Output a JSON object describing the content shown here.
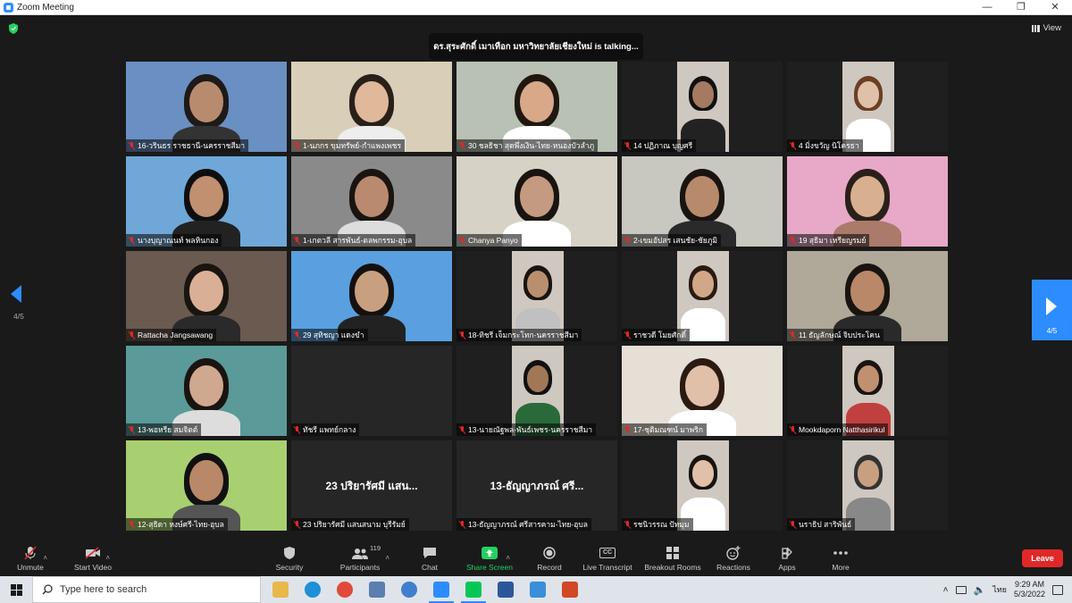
{
  "window": {
    "title": "Zoom Meeting",
    "controls": [
      "—",
      "❐",
      "✕"
    ]
  },
  "meeting": {
    "talking_banner": "ดร.สุระศักดิ์ เมาเทือก มหาวิทยาลัยเชียงใหม่ is talking...",
    "view_label": "View",
    "page_indicator_left": "4/5",
    "page_indicator_right": "4/5"
  },
  "tiles": [
    {
      "name": "16-วรินธร ราชธานี-นครราชสีมา",
      "bg": "#6a8fc2",
      "skin": "#b98b6e",
      "hair": "#1e1a18",
      "shirt": "#333"
    },
    {
      "name": "1-นภกร ขุมทรัพย์-กำแพงเพชร",
      "bg": "#d9cfb8",
      "skin": "#e0b89a",
      "hair": "#2a201a",
      "shirt": "#eee"
    },
    {
      "name": "30 ชลธิชา สุดพึ่งเงิน-ไทย-หนองบัวลำภู",
      "bg": "#b8c1b3",
      "skin": "#d8a888",
      "hair": "#201810",
      "shirt": "#fff"
    },
    {
      "name": "14 ปฏิภาณ บุญศรี",
      "bg": "#1f1f1f",
      "skin": "#a47a60",
      "hair": "#111",
      "shirt": "#222",
      "inset": true
    },
    {
      "name": "4 มิ่งขวัญ นิโครธา",
      "bg": "#222",
      "skin": "#e0c0a8",
      "hair": "#6a3f24",
      "shirt": "#fff",
      "inset": true
    },
    {
      "name": "นางบุญาณนท์ พลหินกอง",
      "bg": "#6fa8d8",
      "skin": "#c09070",
      "hair": "#0f0f0f",
      "shirt": "#222"
    },
    {
      "name": "1-เกตวลี สารพันธ์-ตลพกรรม-อุบล",
      "bg": "#8a8a8a",
      "skin": "#b98a70",
      "hair": "#1a1410",
      "shirt": "#ddd"
    },
    {
      "name": "Chanya Panyo",
      "bg": "#d6d2c6",
      "skin": "#c49a80",
      "hair": "#1a1410",
      "shirt": "#fff"
    },
    {
      "name": "2-เขมอัปสร เสนชัย-ชัยภูมิ",
      "bg": "#c8c8c0",
      "skin": "#b88a6c",
      "hair": "#1a1410",
      "shirt": "#2a2a2a"
    },
    {
      "name": "19 สุธิมา เหรียญรมย์",
      "bg": "#e8a8c8",
      "skin": "#d8b090",
      "hair": "#2a201a",
      "shirt": "#aa7a6a"
    },
    {
      "name": "Rattacha Jangsawang",
      "bg": "#6a5a50",
      "skin": "#d9b095",
      "hair": "#1a1410",
      "shirt": "#2a2a2a"
    },
    {
      "name": "29 สุทิชญา แดงขำ",
      "bg": "#5aa0e0",
      "skin": "#c8a080",
      "hair": "#151010",
      "shirt": "#222"
    },
    {
      "name": "18-ทิชรี เจ็มกระโทก-นครราชสีมา",
      "bg": "#1f1f1f",
      "skin": "#b89070",
      "hair": "#1a1410",
      "shirt": "#c0c0c0",
      "inset": true
    },
    {
      "name": "ราชวดี โมยศักดิ์",
      "bg": "#1f1f1f",
      "skin": "#d0a888",
      "hair": "#2a1a12",
      "shirt": "#fff",
      "inset": true
    },
    {
      "name": "11 ธัญลักษณ์ จิบประโคน",
      "bg": "#b0a898",
      "skin": "#b88868",
      "hair": "#1a1410",
      "shirt": "#2a2a2a"
    },
    {
      "name": "13-พอหรีย สมจิตต์",
      "bg": "#5a9a98",
      "skin": "#d0a890",
      "hair": "#1a1410",
      "shirt": "#ddd"
    },
    {
      "name": "ทัชรี แพทย์กลาง",
      "bg": "#262626",
      "empty": true
    },
    {
      "name": "13-นายณัฐพล-พันธ์เพชร-นครราชสีมา",
      "bg": "#1f1f1f",
      "skin": "#a07858",
      "hair": "#111",
      "shirt": "#2a6a3a",
      "inset": true
    },
    {
      "name": "17-ชุติมณฑน์ มาพริก",
      "bg": "#e6dfd6",
      "skin": "#e0c0a8",
      "hair": "#2a1a12",
      "shirt": "#fff"
    },
    {
      "name": "Mookdaporn Natthasirikul",
      "bg": "#1f1f1f",
      "skin": "#c09070",
      "hair": "#1a1410",
      "shirt": "#c04040",
      "inset": true
    },
    {
      "name": "12-สุธิดา หงษ์ศรี-ไทย-อุบล",
      "bg": "#a8d070",
      "skin": "#b88868",
      "hair": "#111",
      "shirt": "#555"
    },
    {
      "name": "23 ปริยารัศมี แสนสนาม บุรีรัมย์",
      "bg": "#262626",
      "big": "23 ปริยารัศมี แสน..."
    },
    {
      "name": "13-ธัญญาภรณ์ ศรีสารคาม-ไทย-อุบล",
      "bg": "#262626",
      "big": "13-ธัญญาภรณ์ ศรี..."
    },
    {
      "name": "รชนิวรรณ ปัทมุม",
      "bg": "#1f1f1f",
      "skin": "#e0c0a8",
      "hair": "#1a1410",
      "shirt": "#fff",
      "inset": true
    },
    {
      "name": "นราธิป สาริพันธ์",
      "bg": "#1f1f1f",
      "skin": "#c8a080",
      "hair": "#333",
      "shirt": "#888",
      "inset": true
    }
  ],
  "toolbar": {
    "unmute": "Unmute",
    "start_video": "Start Video",
    "security": "Security",
    "participants": "Participants",
    "participants_count": "119",
    "chat": "Chat",
    "share_screen": "Share Screen",
    "record": "Record",
    "live_transcript": "Live Transcript",
    "breakout_rooms": "Breakout Rooms",
    "reactions": "Reactions",
    "apps": "Apps",
    "more": "More",
    "leave": "Leave",
    "cc_label": "CC"
  },
  "taskbar": {
    "search_placeholder": "Type here to search",
    "time": "9:29 AM",
    "date": "5/3/2022",
    "lang": "ไทย",
    "apps": [
      {
        "name": "file-explorer-icon",
        "color": "#e8b84a"
      },
      {
        "name": "edge-icon",
        "color": "#1f8fd8"
      },
      {
        "name": "chrome-icon",
        "color": "#e04a3a"
      },
      {
        "name": "app-icon",
        "color": "#5a7fb0"
      },
      {
        "name": "globe-icon",
        "color": "#3f7fcf"
      },
      {
        "name": "zoom-icon",
        "color": "#2d8cff"
      },
      {
        "name": "line-icon",
        "color": "#06c755"
      },
      {
        "name": "word-icon",
        "color": "#2b579a"
      },
      {
        "name": "photos-icon",
        "color": "#3a8fd8"
      },
      {
        "name": "powerpoint-icon",
        "color": "#d24726"
      }
    ]
  }
}
